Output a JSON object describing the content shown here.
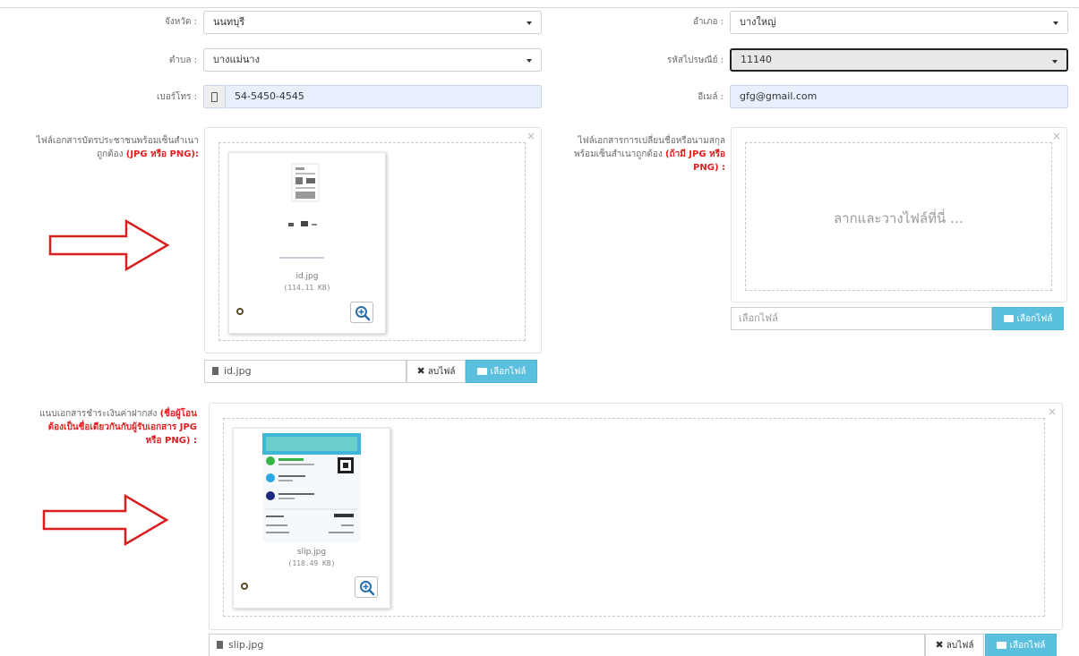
{
  "form": {
    "province": {
      "label": "จังหวัด :",
      "value": "นนทบุรี"
    },
    "district": {
      "label": "อำเภอ :",
      "value": "บางใหญ่"
    },
    "subdistrict": {
      "label": "ตำบล :",
      "value": "บางแม่นาง"
    },
    "postcode": {
      "label": "รหัสไปรษณีย์ :",
      "value": "11140"
    },
    "phone": {
      "label": "เบอร์โทร :",
      "value": "54-5450-4545"
    },
    "email": {
      "label": "อีเมล์ :",
      "value": "gfg@gmail.com"
    }
  },
  "uploads": {
    "id_card": {
      "label_text": "ไฟล์เอกสารบัตรประชาชนพร้อมเซ็นสำเนาถูกต้อง",
      "label_note": "(JPG หรือ PNG):",
      "file_name": "id.jpg",
      "file_size": "(114.11 KB)",
      "caption": "id.jpg",
      "remove_label": "ลบไฟล์",
      "browse_label": "เลือกไฟล์"
    },
    "name_change": {
      "label_text": "ไฟล์เอกสารการเปลี่ยนชื่อหรือนามสกุลพร้อมเซ็นสำเนาถูกต้อง",
      "label_note": "(ถ้ามี JPG หรือ PNG) :",
      "drop_text": "ลากและวางไฟล์ที่นี่ …",
      "caption_placeholder": "เลือกไฟล์",
      "browse_label": "เลือกไฟล์"
    },
    "payment_slip": {
      "label_text": "แนบเอกสารชำระเงินค่าฝากส่ง",
      "label_note": "(ชื่อผู้โอนต้องเป็นชื่อเดียวกันกับผู้รับเอกสาร JPG หรือ PNG) :",
      "file_name": "slip.jpg",
      "file_size": "(118.49 KB)",
      "caption": "slip.jpg",
      "remove_label": "ลบไฟล์",
      "browse_label": "เลือกไฟล์"
    }
  },
  "colors": {
    "accent": "#5bc0de",
    "required_note": "#e02020",
    "arrow": "#d81e1e"
  }
}
